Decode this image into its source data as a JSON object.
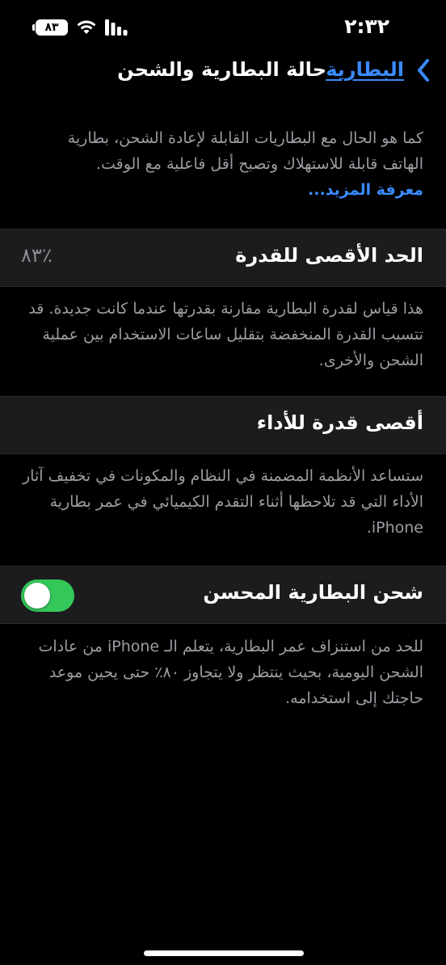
{
  "status_bar": {
    "time": "٢:٣٢",
    "battery_level": "٨٣",
    "wifi_icon": "wifi-icon",
    "signal_icon": "cellular-signal-icon",
    "battery_icon": "battery-icon"
  },
  "nav": {
    "back_label": "البطارية",
    "title": "حالة البطارية والشحن",
    "back_icon": "chevron-left-icon"
  },
  "intro": {
    "text": "كما هو الحال مع البطاريات القابلة لإعادة الشحن، بطارية الهاتف قابلة للاستهلاك وتصبح أقل فاعلية مع الوقت.",
    "learn_more": "معرفة المزيد..."
  },
  "maximum_capacity": {
    "label": "الحد الأقصى للقدرة",
    "value": "٪٨٣",
    "description": "هذا قياس لقدرة البطارية مقارنة بقدرتها عندما كانت جديدة. قد تتسبب القدرة المنخفضة بتقليل ساعات الاستخدام بين عملية الشحن والأخرى."
  },
  "peak_performance": {
    "label": "أقصى قدرة للأداء",
    "description": "ستساعد الأنظمة المضمنة في النظام والمكونات في تخفيف آثار الأداء التي قد تلاحظها أثناء التقدم الكيميائي في عمر بطارية iPhone."
  },
  "optimized_charging": {
    "label": "شحن البطارية المحسن",
    "enabled": true,
    "description": "للحد من استنزاف عمر البطارية، يتعلم الـ iPhone من عادات الشحن اليومية، بحيث ينتظر ولا يتجاوز ٨٠٪ حتى يحين موعد حاجتك إلى استخدامه."
  },
  "colors": {
    "background": "#000000",
    "cell_background": "#1c1c1e",
    "accent_blue": "#3a8bff",
    "toggle_on": "#34c759",
    "secondary_text": "#9c9ca3"
  }
}
